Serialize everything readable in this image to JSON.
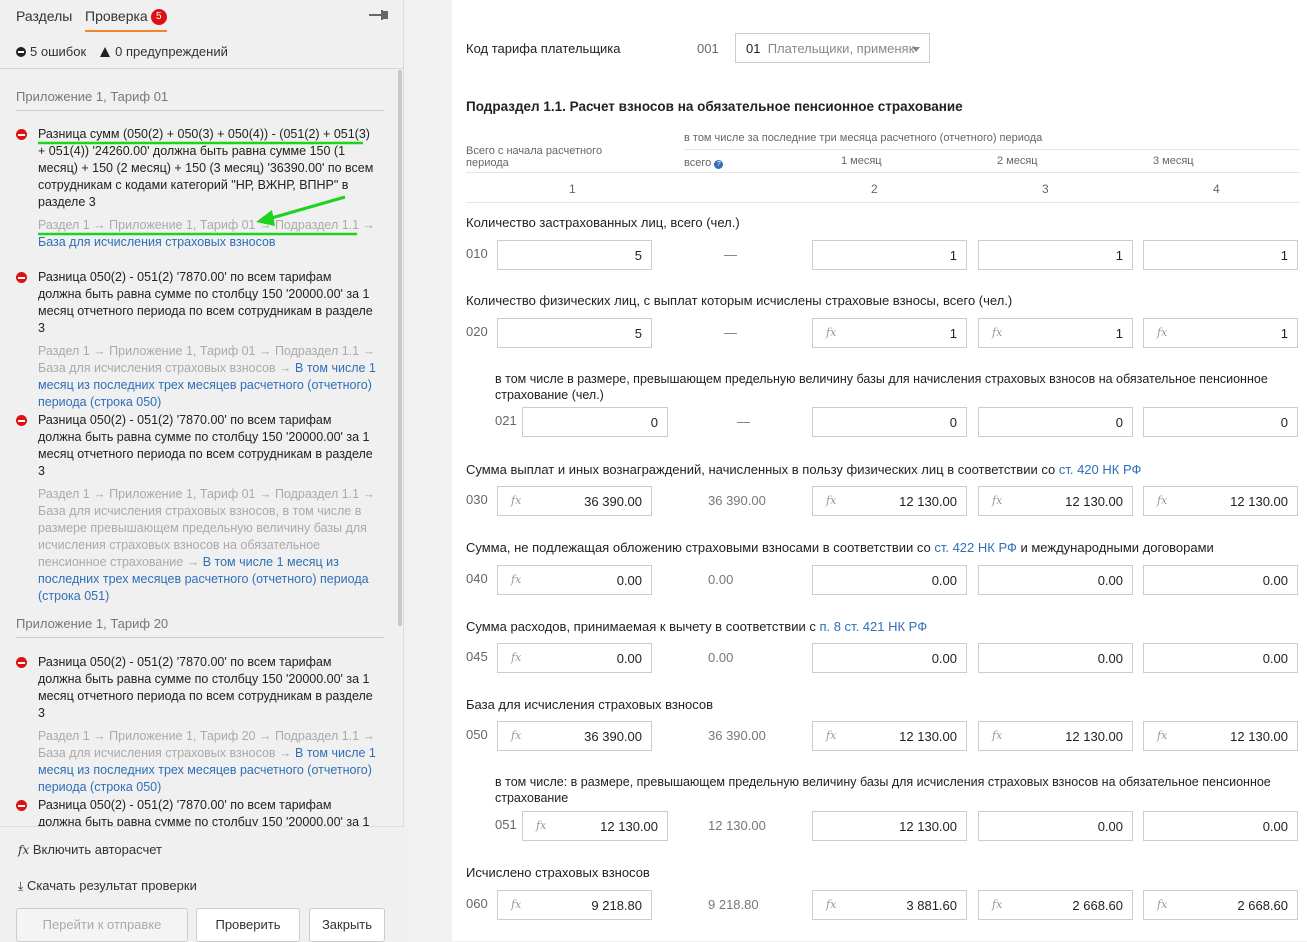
{
  "tabs": {
    "sections": "Разделы",
    "check": "Проверка",
    "badge": "5"
  },
  "summary": {
    "errors": "5 ошибок",
    "warnings": "0 предупреждений"
  },
  "groups": [
    "Приложение 1, Тариф 01",
    "Приложение 1, Тариф 20"
  ],
  "errors": [
    {
      "msg": "Разница сумм (050(2) + 050(3) + 050(4)) - (051(2) + 051(3) + 051(4)) '24260.00' должна быть равна сумме 150 (1 месяц) + 150 (2 месяц) + 150 (3 месяц) '36390.00' по всем сотрудникам с кодами категорий \"НР, ВЖНР, ВПНР\" в разделе 3",
      "path": "Раздел 1 → Приложение 1, Тариф 01 → Подраздел 1.1 →",
      "link": "База для исчисления страховых взносов"
    },
    {
      "msg": "Разница 050(2) - 051(2) '7870.00' по всем тарифам должна быть равна сумме по столбцу 150 '20000.00' за 1 месяц отчетного периода по всем сотрудникам в разделе 3",
      "path": "Раздел 1 → Приложение 1, Тариф 01 → Подраздел 1.1 → База для исчисления страховых взносов →",
      "link": "В том числе 1 месяц из последних трех месяцев расчетного (отчетного) периода (строка 050)"
    },
    {
      "msg": "Разница 050(2) - 051(2) '7870.00' по всем тарифам должна быть равна сумме по столбцу 150 '20000.00' за 1 месяц отчетного периода по всем сотрудникам в разделе 3",
      "path": "Раздел 1 → Приложение 1, Тариф 01 → Подраздел 1.1 → База для исчисления страховых взносов, в том числе в размере превышающем предельную величину базы для исчисления страховых взносов на обязательное пенсионное страхование →",
      "link": "В том числе 1 месяц из последних трех месяцев расчетного (отчетного) периода (строка 051)"
    },
    {
      "msg": "Разница 050(2) - 051(2) '7870.00' по всем тарифам должна быть равна сумме по столбцу 150 '20000.00' за 1 месяц отчетного периода по всем сотрудникам в разделе 3",
      "path": "Раздел 1 → Приложение 1, Тариф 20 → Подраздел 1.1 → База для исчисления страховых взносов →",
      "link": "В том числе 1 месяц из последних трех месяцев расчетного (отчетного) периода (строка 050)"
    },
    {
      "msg": "Разница 050(2) - 051(2) '7870.00' по всем тарифам должна быть равна сумме по столбцу 150 '20000.00' за 1 месяц",
      "path": "",
      "link": ""
    }
  ],
  "actions": {
    "autocalc": "Включить авторасчет",
    "download": "Скачать результат проверки",
    "send": "Перейти к отправке",
    "verify": "Проверить",
    "close": "Закрыть",
    "fx": "fx"
  },
  "form": {
    "tariff_label": "Код тарифа плательщика",
    "tariff_code": "001",
    "tariff_value": "01",
    "tariff_text": "Плательщики, применяк",
    "section_title": "Подраздел 1.1. Расчет взносов на обязательное пенсионное страхование",
    "h_total": "Всего с начала расчетного периода",
    "h_incl": "в том числе за последние три месяца расчетного (отчетного) периода",
    "h_all": "всего",
    "h_m1": "1 месяц",
    "h_m2": "2 месяц",
    "h_m3": "3 месяц",
    "colnums": [
      "1",
      "2",
      "3",
      "4"
    ],
    "dash": "—",
    "rows": [
      {
        "label": "Количество застрахованных лиц, всего (чел.)",
        "code": "010",
        "c1": "5",
        "all": "—",
        "m1": "1",
        "m2": "1",
        "m3": "1"
      },
      {
        "label": "Количество физических лиц, с выплат которым исчислены страховые взносы, всего (чел.)",
        "code": "020",
        "c1": "5",
        "all": "—",
        "m1": "1",
        "m2": "1",
        "m3": "1"
      },
      {
        "label": "в том числе в размере, превышающем предельную величину базы для начисления страховых взносов на обязательное пенсионное страхование (чел.)",
        "code": "021",
        "c1": "0",
        "all": "—",
        "m1": "0",
        "m2": "0",
        "m3": "0"
      },
      {
        "label": "Сумма выплат и иных вознаграждений, начисленных в пользу физических лиц в соответствии со ",
        "link": "ст. 420 НК РФ",
        "code": "030",
        "c1": "36 390.00",
        "all": "36 390.00",
        "m1": "12 130.00",
        "m2": "12 130.00",
        "m3": "12 130.00"
      },
      {
        "label": "Сумма, не подлежащая обложению страховыми взносами в соответствии со ",
        "link": "ст. 422 НК РФ",
        "tail": " и международными договорами",
        "code": "040",
        "c1": "0.00",
        "all": "0.00",
        "m1": "0.00",
        "m2": "0.00",
        "m3": "0.00"
      },
      {
        "label": "Сумма расходов, принимаемая к вычету в соответствии с ",
        "link": "п. 8 ст. 421 НК РФ",
        "code": "045",
        "c1": "0.00",
        "all": "0.00",
        "m1": "0.00",
        "m2": "0.00",
        "m3": "0.00"
      },
      {
        "label": "База для исчисления страховых взносов",
        "code": "050",
        "c1": "36 390.00",
        "all": "36 390.00",
        "m1": "12 130.00",
        "m2": "12 130.00",
        "m3": "12 130.00"
      },
      {
        "label": "в том числе: в размере, превышающем предельную величину базы для исчисления страховых взносов на обязательное пенсионное страхование",
        "code": "051",
        "c1": "12 130.00",
        "all": "12 130.00",
        "m1": "12 130.00",
        "m2": "0.00",
        "m3": "0.00"
      },
      {
        "label": "Исчислено страховых взносов",
        "code": "060",
        "c1": "9 218.80",
        "all": "9 218.80",
        "m1": "3 881.60",
        "m2": "2 668.60",
        "m3": "2 668.60"
      }
    ]
  }
}
